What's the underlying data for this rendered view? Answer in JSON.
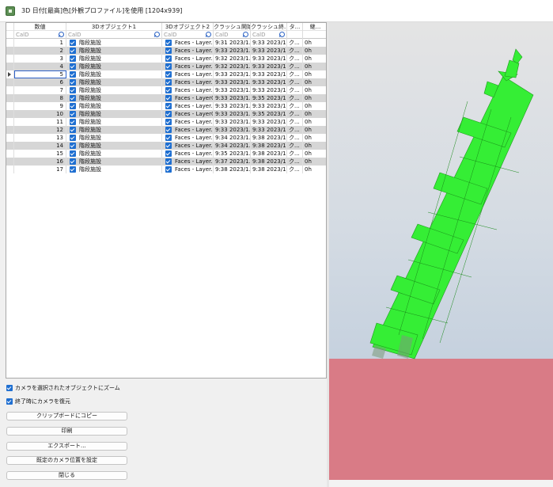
{
  "window": {
    "title": "3D 日付[最高]色[外観プロファイル]を使用  [1204x939]"
  },
  "grid": {
    "columns": {
      "num": "数値",
      "obj1": "3Dオブジェクト1",
      "obj2": "3Dオブジェクト2",
      "start": "クラッシュ開始",
      "end": "クラッシュ終...",
      "type": "タ...",
      "len": "継..."
    },
    "filter_placeholder": "CalD",
    "rows": [
      {
        "num": "1",
        "obj1": "階段施設",
        "obj2": "Faces - Layer...",
        "start": "9:31 2023/1...",
        "end": "9:33 2023/1...",
        "type": "ク...",
        "len": "0h"
      },
      {
        "num": "2",
        "obj1": "階段施設",
        "obj2": "Faces - Layer...",
        "start": "9:33 2023/1...",
        "end": "9:33 2023/1...",
        "type": "ク...",
        "len": "0h"
      },
      {
        "num": "3",
        "obj1": "階段施設",
        "obj2": "Faces - Layer...",
        "start": "9:32 2023/1...",
        "end": "9:33 2023/1...",
        "type": "ク...",
        "len": "0h"
      },
      {
        "num": "4",
        "obj1": "階段施設",
        "obj2": "Faces - Layer...",
        "start": "9:32 2023/1...",
        "end": "9:33 2023/1...",
        "type": "ク...",
        "len": "0h"
      },
      {
        "num": "5",
        "obj1": "階段施設",
        "obj2": "Faces - Layer...",
        "start": "9:33 2023/1...",
        "end": "9:33 2023/1...",
        "type": "ク...",
        "len": "0h"
      },
      {
        "num": "6",
        "obj1": "階段施設",
        "obj2": "Faces - Layer...",
        "start": "9:33 2023/1...",
        "end": "9:33 2023/1...",
        "type": "ク...",
        "len": "0h"
      },
      {
        "num": "7",
        "obj1": "階段施設",
        "obj2": "Faces - Layer...",
        "start": "9:33 2023/1...",
        "end": "9:33 2023/1...",
        "type": "ク...",
        "len": "0h"
      },
      {
        "num": "8",
        "obj1": "階段施設",
        "obj2": "Faces - Layer0",
        "start": "9:33 2023/1...",
        "end": "9:35 2023/1...",
        "type": "ク...",
        "len": "0h"
      },
      {
        "num": "9",
        "obj1": "階段施設",
        "obj2": "Faces - Layer...",
        "start": "9:33 2023/1...",
        "end": "9:33 2023/1...",
        "type": "ク...",
        "len": "0h"
      },
      {
        "num": "10",
        "obj1": "階段施設",
        "obj2": "Faces - Layer0",
        "start": "9:33 2023/1...",
        "end": "9:35 2023/1...",
        "type": "ク...",
        "len": "0h"
      },
      {
        "num": "11",
        "obj1": "階段施設",
        "obj2": "Faces - Layer...",
        "start": "9:33 2023/1...",
        "end": "9:33 2023/1...",
        "type": "ク...",
        "len": "0h"
      },
      {
        "num": "12",
        "obj1": "階段施設",
        "obj2": "Faces - Layer...",
        "start": "9:33 2023/1...",
        "end": "9:33 2023/1...",
        "type": "ク...",
        "len": "0h"
      },
      {
        "num": "13",
        "obj1": "階段施設",
        "obj2": "Faces - Layer...",
        "start": "9:34 2023/1...",
        "end": "9:38 2023/1...",
        "type": "ク...",
        "len": "0h"
      },
      {
        "num": "14",
        "obj1": "階段施設",
        "obj2": "Faces - Layer...",
        "start": "9:34 2023/1...",
        "end": "9:38 2023/1...",
        "type": "ク...",
        "len": "0h"
      },
      {
        "num": "15",
        "obj1": "階段施設",
        "obj2": "Faces - Layer...",
        "start": "9:35 2023/1...",
        "end": "9:38 2023/1...",
        "type": "ク...",
        "len": "0h"
      },
      {
        "num": "16",
        "obj1": "階段施設",
        "obj2": "Faces - Layer...",
        "start": "9:37 2023/1...",
        "end": "9:38 2023/1...",
        "type": "ク...",
        "len": "0h"
      },
      {
        "num": "17",
        "obj1": "階段施設",
        "obj2": "Faces - Layer...",
        "start": "9:38 2023/1...",
        "end": "9:38 2023/1...",
        "type": "ク...",
        "len": "0h"
      }
    ]
  },
  "options": {
    "zoom_to_selected": "カメラを選択されたオブジェクトにズーム",
    "restore_camera": "終了時にカメラを復元"
  },
  "buttons": {
    "copy": "クリップボードにコピー",
    "print": "印刷",
    "export": "エクスポート...",
    "set_camera": "既定のカメラ位置を設定",
    "close": "閉じる"
  },
  "colors": {
    "model": "#33ee33",
    "ground": "#d97b86",
    "checkbox": "#1f6fd1"
  }
}
